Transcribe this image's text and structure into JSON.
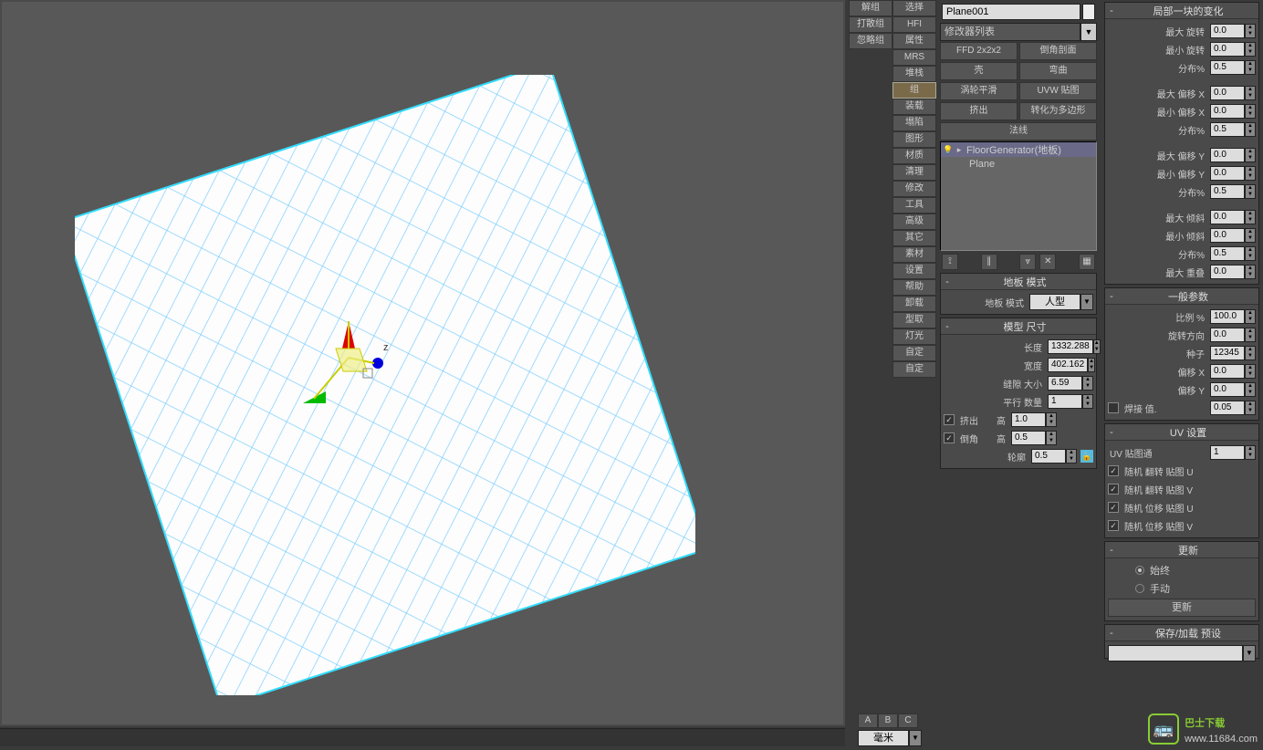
{
  "object_name": "Plane001",
  "modifier_list_label": "修改器列表",
  "mod_buttons": [
    "FFD 2x2x2",
    "倒角剖面",
    "壳",
    "弯曲",
    "涡轮平滑",
    "UVW 贴图",
    "挤出",
    "转化为多边形",
    "法线"
  ],
  "modstack": [
    {
      "label": "FloorGenerator(地板)",
      "sel": true,
      "has_icons": true
    },
    {
      "label": "Plane",
      "sel": false,
      "has_icons": false
    }
  ],
  "sidebar": {
    "rows": [
      [
        "解组",
        "选择"
      ],
      [
        "打散组",
        "HFI"
      ],
      [
        "忽略组",
        "属性"
      ],
      [
        "",
        "MRS"
      ],
      [
        "",
        "堆栈"
      ],
      [
        "",
        "组"
      ],
      [
        "",
        "装载"
      ],
      [
        "",
        "塌陷"
      ],
      [
        "",
        "图形"
      ],
      [
        "",
        "材质"
      ],
      [
        "",
        "清理"
      ],
      [
        "",
        "修改"
      ],
      [
        "",
        "工具"
      ],
      [
        "",
        "高级"
      ],
      [
        "",
        "其它"
      ],
      [
        "",
        "素材"
      ],
      [
        "",
        "设置"
      ],
      [
        "",
        "帮助"
      ],
      [
        "",
        "卸载"
      ],
      [
        "",
        "型取"
      ],
      [
        "",
        "灯光"
      ],
      [
        "",
        "自定"
      ],
      [
        "",
        "自定"
      ]
    ],
    "active_row": 5
  },
  "abc": [
    "A",
    "B",
    "C"
  ],
  "units": {
    "label": "毫米"
  },
  "floor_pattern": {
    "title": "地板 模式",
    "mode_label": "地板 模式",
    "mode_value": "人型"
  },
  "model_size": {
    "title": "模型 尺寸",
    "length_label": "长度",
    "length": "1332.288",
    "width_label": "宽度",
    "width": "402.162",
    "gap_label": "缝隙 大小",
    "gap": "6.59",
    "parallel_label": "平行 数量",
    "parallel": "1",
    "extrude_cb": "挤出",
    "extrude_h_label": "高",
    "extrude_h": "1.0",
    "chamfer_cb": "倒角",
    "chamfer_h_label": "高",
    "chamfer_h": "0.5",
    "outline_label": "轮廓",
    "outline": "0.5"
  },
  "local_var": {
    "title": "局部一块的变化",
    "r1": "最大 旋转",
    "v1": "0.0",
    "r2": "最小 旋转",
    "v2": "0.0",
    "r3": "分布%",
    "v3": "0.5",
    "r4": "最大 偏移 X",
    "v4": "0.0",
    "r5": "最小 偏移 X",
    "v5": "0.0",
    "r6": "分布%",
    "v6": "0.5",
    "r7": "最大 偏移 Y",
    "v7": "0.0",
    "r8": "最小 偏移 Y",
    "v8": "0.0",
    "r9": "分布%",
    "v9": "0.5",
    "r10": "最大 倾斜",
    "v10": "0.0",
    "r11": "最小 倾斜",
    "v11": "0.0",
    "r12": "分布%",
    "v12": "0.5",
    "r13": "最大 重叠",
    "v13": "0.0"
  },
  "general": {
    "title": "一般参数",
    "scale_label": "比例 %",
    "scale": "100.0",
    "rotdir_label": "旋转方向",
    "rotdir": "0.0",
    "seed_label": "种子",
    "seed": "12345",
    "offx_label": "偏移 X",
    "offx": "0.0",
    "offy_label": "偏移 Y",
    "offy": "0.0",
    "weld_label": "焊接 值.",
    "weld": "0.05"
  },
  "uv": {
    "title": "UV 设置",
    "chan_label": "UV 贴图通",
    "chan": "1",
    "c1": "随机 翻转 贴图 U",
    "c2": "随机 翻转 贴图 V",
    "c3": "随机 位移 贴图 U",
    "c4": "随机 位移 贴图 V"
  },
  "update": {
    "title": "更新",
    "always": "始终",
    "manual": "手动",
    "btn": "更新"
  },
  "preset": {
    "title": "保存/加载 预设"
  },
  "site": {
    "t1": "巴士下载",
    "t2": "www.11684.com"
  }
}
